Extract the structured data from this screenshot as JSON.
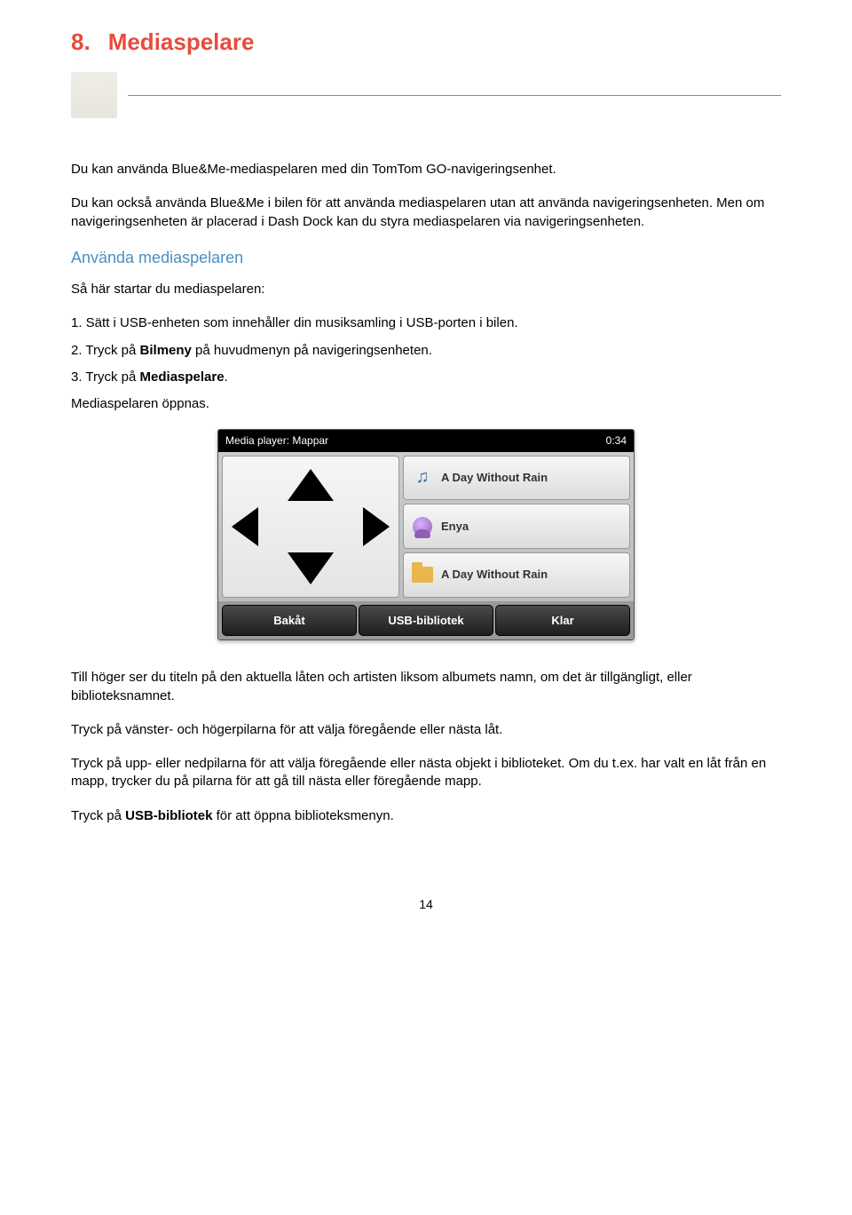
{
  "chapter": {
    "number": "8.",
    "title": "Mediaspelare"
  },
  "intro1": "Du kan använda Blue&Me-mediaspelaren med din TomTom GO-navigeringsenhet.",
  "intro2": "Du kan också använda Blue&Me i bilen för att använda mediaspelaren utan att använda navigeringsenheten. Men om navigeringsenheten är placerad i Dash Dock kan du styra mediaspelaren via navigeringsenheten.",
  "subhead": "Använda mediaspelaren",
  "lead": "Så här startar du mediaspelaren:",
  "step1": "1. Sätt i USB-enheten som innehåller din musiksamling i USB-porten i bilen.",
  "step2_a": "2. Tryck på ",
  "step2_b": "Bilmeny",
  "step2_c": " på huvudmenyn på navigeringsenheten.",
  "step3_a": "3. Tryck på ",
  "step3_b": "Mediaspelare",
  "step3_c": ".",
  "opened": "Mediaspelaren öppnas.",
  "device": {
    "top_left": "Media player: Mappar",
    "top_right": "0:34",
    "row_song": "A Day Without Rain",
    "row_artist": "Enya",
    "row_album": "A Day Without Rain",
    "btn_back": "Bakåt",
    "btn_lib": "USB-bibliotek",
    "btn_done": "Klar"
  },
  "after1": "Till höger ser du titeln på den aktuella låten och artisten liksom albumets namn, om det är tillgängligt, eller biblioteksnamnet.",
  "after2": "Tryck på vänster- och högerpilarna för att välja föregående eller nästa låt.",
  "after3": "Tryck på upp- eller nedpilarna för att välja föregående eller nästa objekt i biblioteket. Om du t.ex. har valt en låt från en mapp, trycker du på pilarna för att gå till nästa eller föregående mapp.",
  "after4_a": "Tryck på ",
  "after4_b": "USB-bibliotek",
  "after4_c": " för att öppna biblioteksmenyn.",
  "page_number": "14"
}
